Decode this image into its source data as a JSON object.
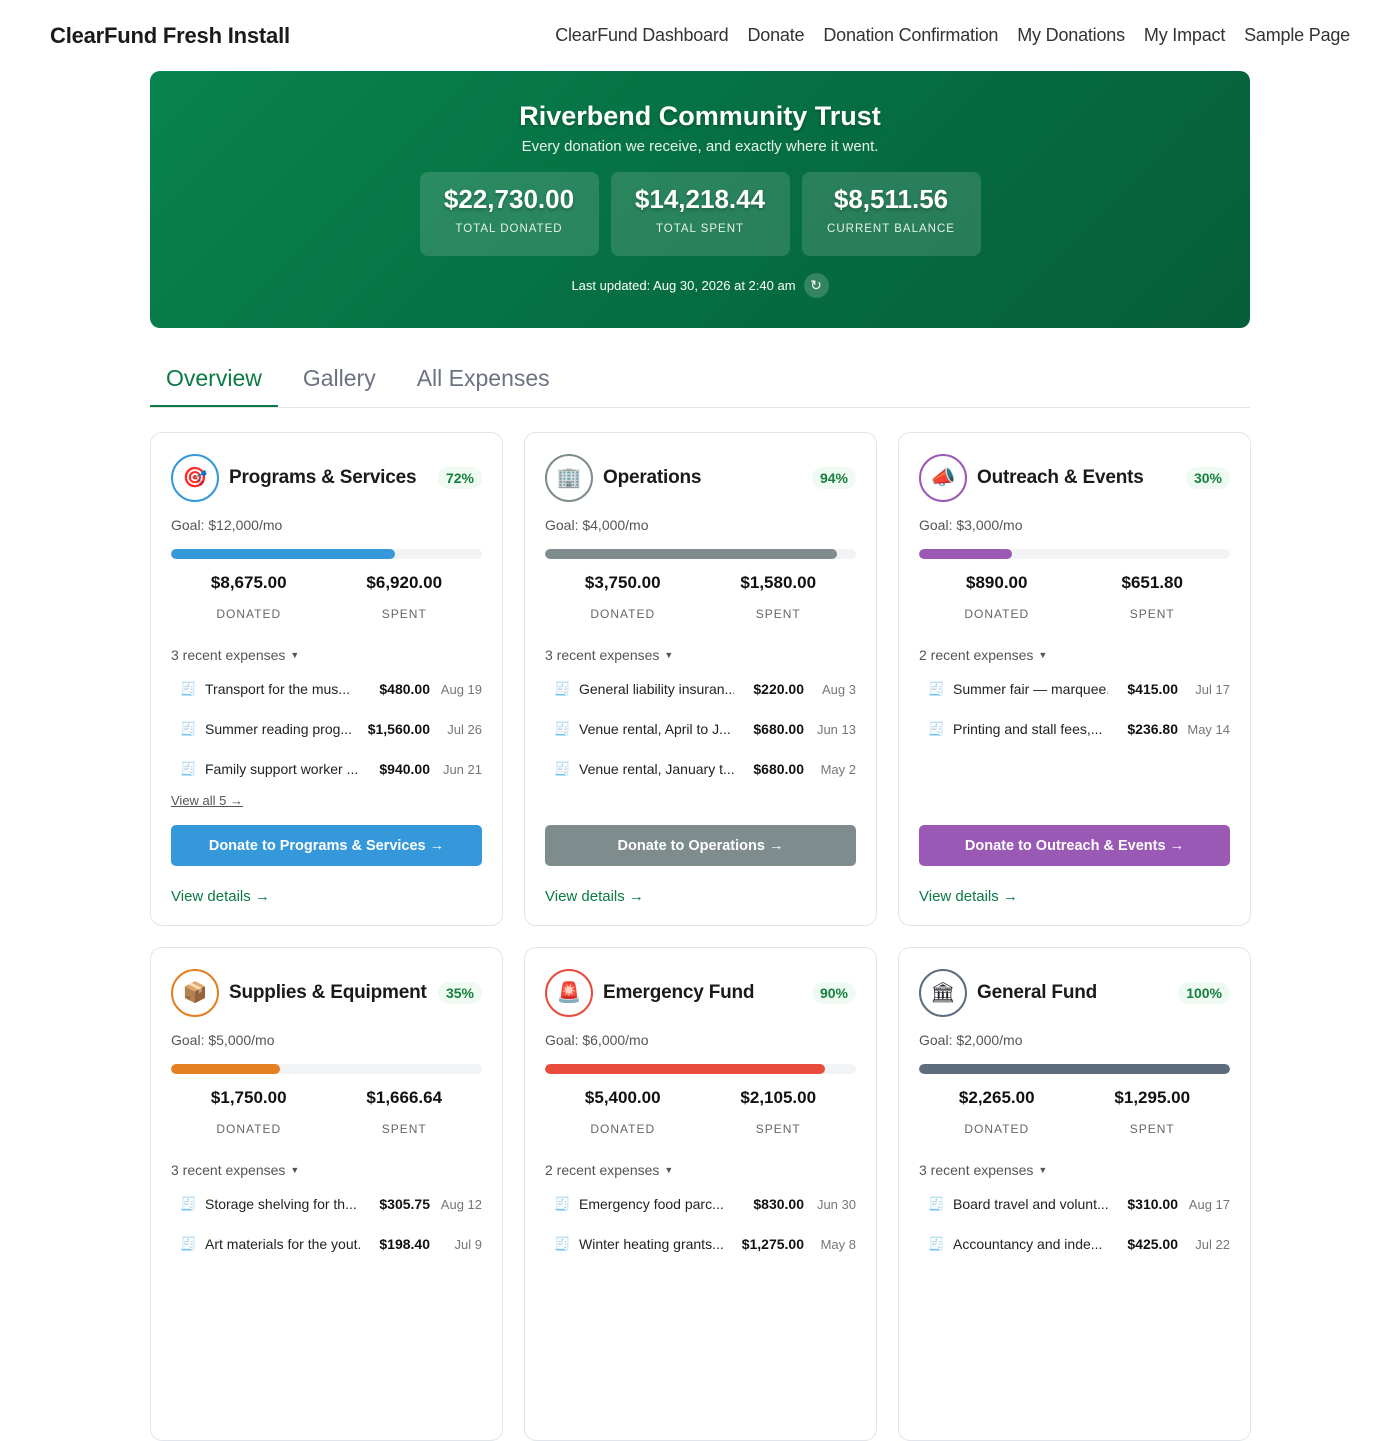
{
  "site": {
    "title": "ClearFund Fresh Install"
  },
  "nav": [
    "ClearFund Dashboard",
    "Donate",
    "Donation Confirmation",
    "My Donations",
    "My Impact",
    "Sample Page"
  ],
  "hero": {
    "title": "Riverbend Community Trust",
    "subtitle": "Every donation we receive, and exactly where it went.",
    "stats": [
      {
        "value": "$22,730.00",
        "label": "TOTAL DONATED"
      },
      {
        "value": "$14,218.44",
        "label": "TOTAL SPENT"
      },
      {
        "value": "$8,511.56",
        "label": "CURRENT BALANCE"
      }
    ],
    "updated": "Last updated: Aug 30, 2026 at 2:40 am",
    "refresh_icon": "↻"
  },
  "tabs": [
    "Overview",
    "Gallery",
    "All Expenses"
  ],
  "labels": {
    "donated": "DONATED",
    "spent": "SPENT",
    "view_details": "View details →"
  },
  "categories": [
    {
      "name": "Programs & Services",
      "icon": "target-icon",
      "glyph": "🎯",
      "color": "#3498db",
      "pct": "72%",
      "progress": 0.72,
      "goal": "Goal: $12,000/mo",
      "donated": "$8,675.00",
      "spent": "$6,920.00",
      "recent": "3 recent expenses",
      "expenses": [
        {
          "desc": "Transport for the mus...",
          "amount": "$480.00",
          "date": "Aug 19"
        },
        {
          "desc": "Summer reading prog...",
          "amount": "$1,560.00",
          "date": "Jul 26"
        },
        {
          "desc": "Family support worker ...",
          "amount": "$940.00",
          "date": "Jun 21"
        }
      ],
      "view_all": "View all 5 →",
      "donate": "Donate to Programs & Services →"
    },
    {
      "name": "Operations",
      "icon": "office-building-icon",
      "glyph": "🏢",
      "color": "#7f8c8d",
      "pct": "94%",
      "progress": 0.94,
      "goal": "Goal: $4,000/mo",
      "donated": "$3,750.00",
      "spent": "$1,580.00",
      "recent": "3 recent expenses",
      "expenses": [
        {
          "desc": "General liability insuran...",
          "amount": "$220.00",
          "date": "Aug 3"
        },
        {
          "desc": "Venue rental, April to J...",
          "amount": "$680.00",
          "date": "Jun 13"
        },
        {
          "desc": "Venue rental, January t...",
          "amount": "$680.00",
          "date": "May 2"
        }
      ],
      "view_all": "",
      "donate": "Donate to Operations →"
    },
    {
      "name": "Outreach & Events",
      "icon": "megaphone-icon",
      "glyph": "📣",
      "color": "#9b59b6",
      "pct": "30%",
      "progress": 0.3,
      "goal": "Goal: $3,000/mo",
      "donated": "$890.00",
      "spent": "$651.80",
      "recent": "2 recent expenses",
      "expenses": [
        {
          "desc": "Summer fair — marquee...",
          "amount": "$415.00",
          "date": "Jul 17"
        },
        {
          "desc": "Printing and stall fees,...",
          "amount": "$236.80",
          "date": "May 14"
        }
      ],
      "view_all": "",
      "donate": "Donate to Outreach & Events →"
    },
    {
      "name": "Supplies & Equipment",
      "icon": "package-icon",
      "glyph": "📦",
      "color": "#e67e22",
      "pct": "35%",
      "progress": 0.35,
      "goal": "Goal: $5,000/mo",
      "donated": "$1,750.00",
      "spent": "$1,666.64",
      "recent": "3 recent expenses",
      "expenses": [
        {
          "desc": "Storage shelving for th...",
          "amount": "$305.75",
          "date": "Aug 12"
        },
        {
          "desc": "Art materials for the yout...",
          "amount": "$198.40",
          "date": "Jul 9"
        }
      ],
      "view_all": "",
      "donate": ""
    },
    {
      "name": "Emergency Fund",
      "icon": "siren-icon",
      "glyph": "🚨",
      "color": "#e74c3c",
      "pct": "90%",
      "progress": 0.9,
      "goal": "Goal: $6,000/mo",
      "donated": "$5,400.00",
      "spent": "$2,105.00",
      "recent": "2 recent expenses",
      "expenses": [
        {
          "desc": "Emergency food parc...",
          "amount": "$830.00",
          "date": "Jun 30"
        },
        {
          "desc": "Winter heating grants...",
          "amount": "$1,275.00",
          "date": "May 8"
        }
      ],
      "view_all": "",
      "donate": ""
    },
    {
      "name": "General Fund",
      "icon": "bank-icon",
      "glyph": "🏛",
      "color": "#5d6d7e",
      "pct": "100%",
      "progress": 1.0,
      "goal": "Goal: $2,000/mo",
      "donated": "$2,265.00",
      "spent": "$1,295.00",
      "recent": "3 recent expenses",
      "expenses": [
        {
          "desc": "Board travel and volunt...",
          "amount": "$310.00",
          "date": "Aug 17"
        },
        {
          "desc": "Accountancy and inde...",
          "amount": "$425.00",
          "date": "Jul 22"
        }
      ],
      "view_all": "",
      "donate": ""
    }
  ]
}
